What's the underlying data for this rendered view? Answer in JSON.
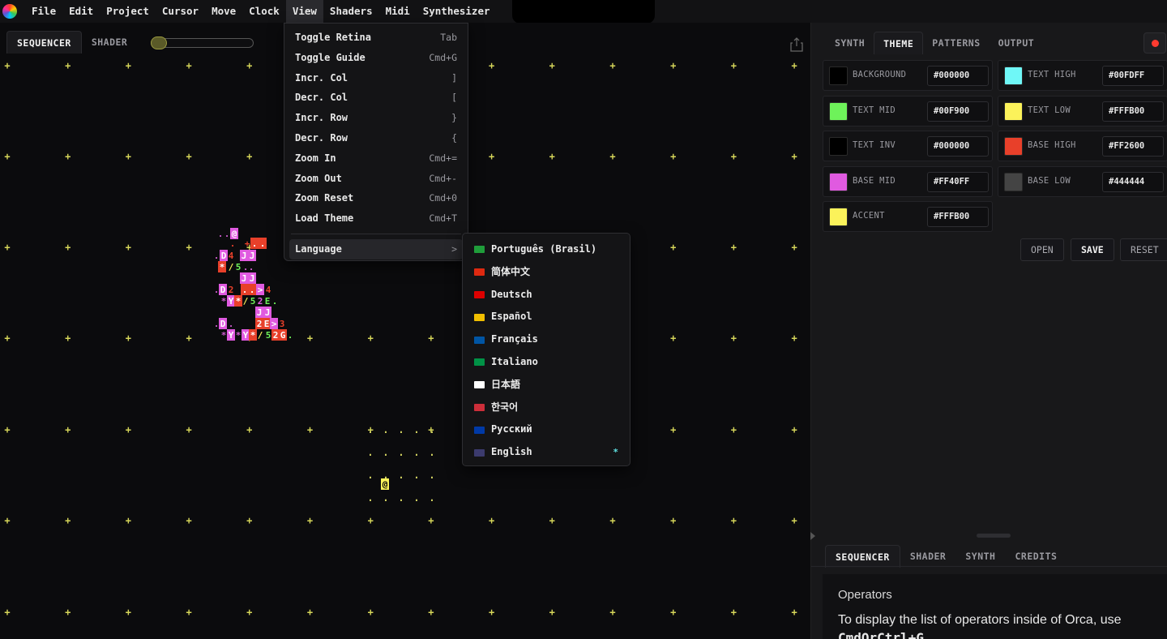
{
  "menubar": {
    "items": [
      "File",
      "Edit",
      "Project",
      "Cursor",
      "Move",
      "Clock",
      "View",
      "Shaders",
      "Midi",
      "Synthesizer"
    ],
    "active": "View"
  },
  "left_panel": {
    "tabs": [
      "SEQUENCER",
      "SHADER"
    ],
    "selected_tab": "SEQUENCER",
    "grid_marker": "+",
    "cursor_char": "@"
  },
  "view_menu": {
    "items": [
      {
        "label": "Toggle Retina",
        "shortcut": "Tab"
      },
      {
        "label": "Toggle Guide",
        "shortcut": "Cmd+G"
      },
      {
        "label": "Incr. Col",
        "shortcut": "]"
      },
      {
        "label": "Decr. Col",
        "shortcut": "["
      },
      {
        "label": "Incr. Row",
        "shortcut": "}"
      },
      {
        "label": "Decr. Row",
        "shortcut": "{"
      },
      {
        "label": "Zoom In",
        "shortcut": "Cmd+="
      },
      {
        "label": "Zoom Out",
        "shortcut": "Cmd+-"
      },
      {
        "label": "Zoom Reset",
        "shortcut": "Cmd+0"
      },
      {
        "label": "Load Theme",
        "shortcut": "Cmd+T"
      }
    ],
    "submenu": {
      "label": "Language",
      "arrow": ">"
    }
  },
  "language_menu": {
    "items": [
      {
        "label": "Português (Brasil)",
        "flag": "#1f9d3a"
      },
      {
        "label": "简体中文",
        "flag": "#de2910"
      },
      {
        "label": "Deutsch",
        "flag": "#dd0000"
      },
      {
        "label": "Español",
        "flag": "#f1bf00"
      },
      {
        "label": "Français",
        "flag": "#0055a4"
      },
      {
        "label": "Italiano",
        "flag": "#009246"
      },
      {
        "label": "日本語",
        "flag": "#ffffff"
      },
      {
        "label": "한국어",
        "flag": "#cd2e3a"
      },
      {
        "label": "Русский",
        "flag": "#0039a6"
      },
      {
        "label": "English",
        "flag": "#3c3b6e"
      }
    ],
    "selected": "English",
    "check_mark": "*"
  },
  "right_panel": {
    "tabs": [
      "SYNTH",
      "THEME",
      "PATTERNS",
      "OUTPUT"
    ],
    "selected_tab": "THEME",
    "theme": [
      {
        "label": "BACKGROUND",
        "value": "#000000",
        "color": "#000000"
      },
      {
        "label": "TEXT HIGH",
        "value": "#00FDFF",
        "color": "#6ff7f7"
      },
      {
        "label": "TEXT MID",
        "value": "#00F900",
        "color": "#6ef25a"
      },
      {
        "label": "TEXT LOW",
        "value": "#FFFB00",
        "color": "#fbf25a"
      },
      {
        "label": "TEXT INV",
        "value": "#000000",
        "color": "#000000"
      },
      {
        "label": "BASE HIGH",
        "value": "#FF2600",
        "color": "#e8402a"
      },
      {
        "label": "BASE MID",
        "value": "#FF40FF",
        "color": "#e05ae0"
      },
      {
        "label": "BASE LOW",
        "value": "#444444",
        "color": "#444444"
      },
      {
        "label": "ACCENT",
        "value": "#FFFB00",
        "color": "#fbf25a"
      }
    ],
    "buttons": {
      "open": "OPEN",
      "save": "SAVE",
      "reset": "RESET"
    },
    "bottom_tabs": [
      "SEQUENCER",
      "SHADER",
      "SYNTH",
      "CREDITS"
    ],
    "bottom_selected": "SEQUENCER",
    "doc": {
      "title": "Operators",
      "text": "To display the list of operators inside of Orca, use",
      "code": "CmdOrCtrl+G"
    }
  },
  "colors": {
    "grid_marker": "#d7d75a",
    "dots": "#cfcf60",
    "mid": "#e8402a",
    "high": "#e05ae0",
    "text": "#6ef25a",
    "cursor_bg": "#fbf25a"
  },
  "glyphs": [
    {
      "t": ".",
      "c": "#cf5ccf",
      "bg": ""
    },
    {
      "t": ".",
      "c": "#cf5ccf",
      "bg": ""
    },
    {
      "t": "@",
      "c": "#fff",
      "bg": "#e05ae0"
    },
    {
      "t": ".",
      "c": "#e8402a",
      "bg": ""
    },
    {
      "t": "+",
      "c": "#e8402a",
      "bg": ""
    },
    {
      "t": ".",
      "c": "#fff",
      "bg": "#e8402a"
    },
    {
      "t": ".",
      "c": "#fff",
      "bg": "#e8402a"
    },
    {
      "t": ".",
      "c": "#cf5ccf",
      "bg": ""
    },
    {
      "t": "D",
      "c": "#fff",
      "bg": "#e05ae0"
    },
    {
      "t": "4",
      "c": "#e8402a",
      "bg": ""
    },
    {
      "t": "J",
      "c": "#fff",
      "bg": "#e05ae0"
    },
    {
      "t": "J",
      "c": "#fff",
      "bg": "#e05ae0"
    },
    {
      "t": "*",
      "c": "#fff",
      "bg": "#e8402a"
    },
    {
      "t": "/",
      "c": "#fbf25a",
      "bg": ""
    },
    {
      "t": "5",
      "c": "#6ef25a",
      "bg": ""
    },
    {
      "t": ".",
      "c": "#cf5ccf",
      "bg": ""
    },
    {
      "t": ".",
      "c": "#cf5ccf",
      "bg": ""
    },
    {
      "t": "J",
      "c": "#fff",
      "bg": "#e05ae0"
    },
    {
      "t": "J",
      "c": "#fff",
      "bg": "#e05ae0"
    },
    {
      "t": ".",
      "c": "#cf5ccf",
      "bg": ""
    },
    {
      "t": "D",
      "c": "#fff",
      "bg": "#e05ae0"
    },
    {
      "t": "2",
      "c": "#e8402a",
      "bg": ""
    },
    {
      "t": ".",
      "c": "#fff",
      "bg": "#e8402a"
    },
    {
      "t": ".",
      "c": "#fff",
      "bg": "#e8402a"
    },
    {
      "t": ">",
      "c": "#fff",
      "bg": "#e05ae0"
    },
    {
      "t": "4",
      "c": "#e8402a",
      "bg": ""
    },
    {
      "t": "*",
      "c": "#cf5ccf",
      "bg": ""
    },
    {
      "t": "Y",
      "c": "#fff",
      "bg": "#e05ae0"
    },
    {
      "t": "*",
      "c": "#fff",
      "bg": "#e8402a"
    },
    {
      "t": "/",
      "c": "#fbf25a",
      "bg": ""
    },
    {
      "t": "5",
      "c": "#6ef25a",
      "bg": ""
    },
    {
      "t": "2",
      "c": "#e05ae0",
      "bg": ""
    },
    {
      "t": "E",
      "c": "#6ef25a",
      "bg": ""
    },
    {
      "t": ".",
      "c": "#6ef25a",
      "bg": ""
    },
    {
      "t": "J",
      "c": "#fff",
      "bg": "#e05ae0"
    },
    {
      "t": "J",
      "c": "#fff",
      "bg": "#e05ae0"
    },
    {
      "t": ".",
      "c": "#cf5ccf",
      "bg": ""
    },
    {
      "t": "D",
      "c": "#fff",
      "bg": "#e05ae0"
    },
    {
      "t": ".",
      "c": "#cf5ccf",
      "bg": ""
    },
    {
      "t": "2",
      "c": "#fff",
      "bg": "#e8402a"
    },
    {
      "t": "E",
      "c": "#fff",
      "bg": "#e8402a"
    },
    {
      "t": ">",
      "c": "#fff",
      "bg": "#e05ae0"
    },
    {
      "t": "3",
      "c": "#e8402a",
      "bg": ""
    },
    {
      "t": "*",
      "c": "#cf5ccf",
      "bg": ""
    },
    {
      "t": "Y",
      "c": "#fff",
      "bg": "#e05ae0"
    },
    {
      "t": "*",
      "c": "#cf5ccf",
      "bg": ""
    },
    {
      "t": "Y",
      "c": "#fff",
      "bg": "#e05ae0"
    },
    {
      "t": "*",
      "c": "#fff",
      "bg": "#e8402a"
    },
    {
      "t": "/",
      "c": "#fbf25a",
      "bg": ""
    },
    {
      "t": "5",
      "c": "#6ef25a",
      "bg": ""
    },
    {
      "t": "2",
      "c": "#fff",
      "bg": "#e8402a"
    },
    {
      "t": "G",
      "c": "#fff",
      "bg": "#e8402a"
    },
    {
      "t": ".",
      "c": "#6ef25a",
      "bg": ""
    }
  ]
}
